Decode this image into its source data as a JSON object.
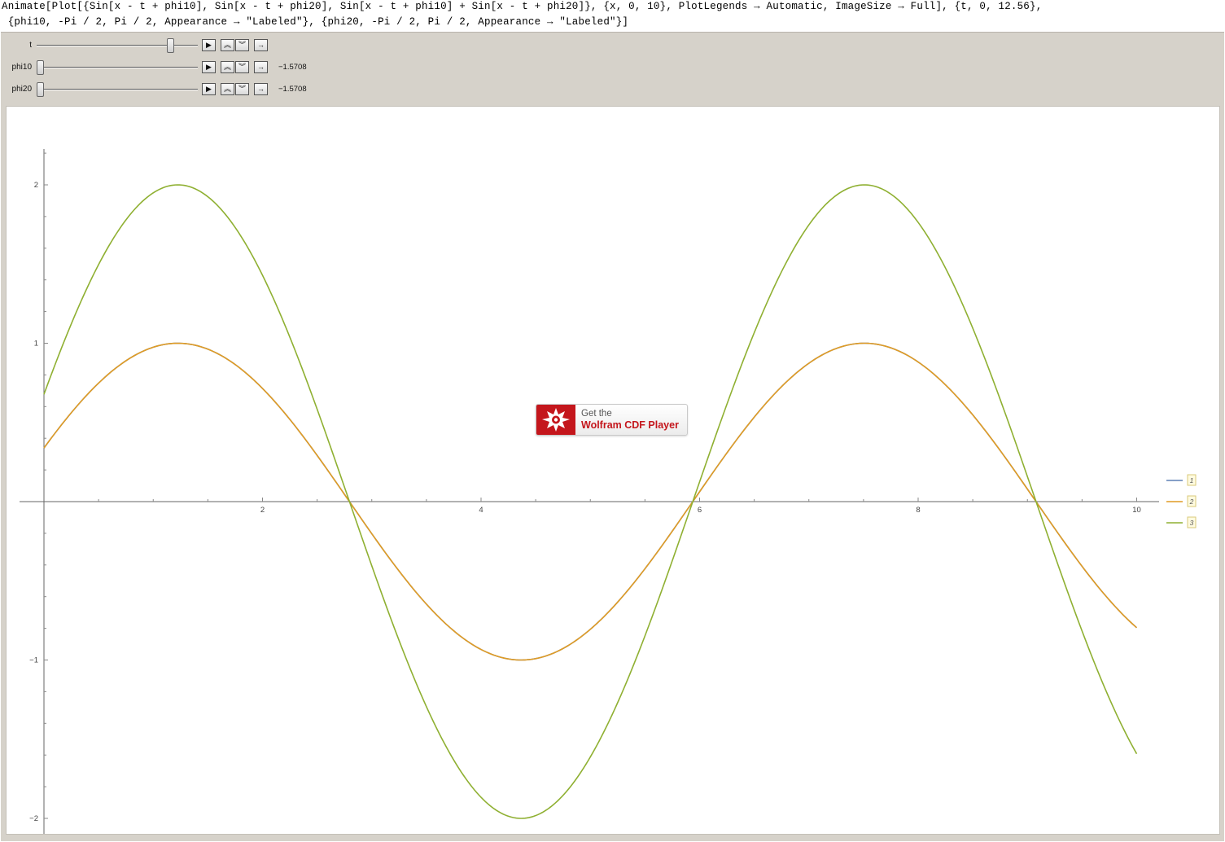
{
  "code": {
    "line1": "Animate[Plot[{Sin[x - t + phi10], Sin[x - t + phi20], Sin[x - t + phi10] + Sin[x - t + phi20]}, {x, 0, 10}, PlotLegends → Automatic, ImageSize → Full], {t, 0, 12.56},",
    "line2": " {phi10, -Pi / 2, Pi / 2, Appearance → \"Labeled\"}, {phi20, -Pi / 2, Pi / 2, Appearance → \"Labeled\"}]"
  },
  "controls": [
    {
      "label": "t",
      "value": "",
      "fraction": 0.848
    },
    {
      "label": "phi10",
      "value": "−1.5708",
      "fraction": 0.0
    },
    {
      "label": "phi20",
      "value": "−1.5708",
      "fraction": 0.0
    }
  ],
  "control_buttons": {
    "play_icon": "play-icon",
    "faster_icon": "double-chevron-up-icon",
    "slower_icon": "double-chevron-down-icon",
    "direction_icon": "arrow-right-icon"
  },
  "cdf_badge": {
    "line1": "Get the",
    "line2": "Wolfram CDF Player"
  },
  "chart_data": {
    "type": "line",
    "title": "",
    "xlabel": "",
    "ylabel": "",
    "xlim": [
      0,
      10
    ],
    "ylim": [
      -2.2,
      2.2
    ],
    "x_ticks": [
      "2",
      "4",
      "6",
      "8",
      "10"
    ],
    "y_ticks": [
      "2",
      "1",
      "−1",
      "−2"
    ],
    "grid": false,
    "legend_position": "right",
    "parameters": {
      "t": 10.65,
      "phi10": -1.5708,
      "phi20": -1.5708
    },
    "series": [
      {
        "name": "1",
        "expression": "Sin[x - t + phi10]",
        "color": "#5e81b5",
        "x": [
          0,
          1.42,
          3.0,
          4.56,
          6.14,
          7.7,
          9.28,
          10
        ],
        "y": [
          0.13,
          1.0,
          0.0,
          -1.0,
          0.0,
          1.0,
          0.0,
          -0.64
        ]
      },
      {
        "name": "2",
        "expression": "Sin[x - t + phi20]",
        "color": "#e19c24",
        "x": [
          0,
          1.42,
          3.0,
          4.56,
          6.14,
          7.7,
          9.28,
          10
        ],
        "y": [
          0.13,
          1.0,
          0.0,
          -1.0,
          0.0,
          1.0,
          0.0,
          -0.64
        ]
      },
      {
        "name": "3",
        "expression": "Sin[x - t + phi10] + Sin[x - t + phi20]",
        "color": "#8fb032",
        "x": [
          0,
          1.42,
          3.0,
          4.56,
          6.14,
          7.7,
          9.28,
          10
        ],
        "y": [
          0.25,
          2.0,
          0.0,
          -2.0,
          0.0,
          2.0,
          0.0,
          -1.28
        ]
      }
    ]
  }
}
